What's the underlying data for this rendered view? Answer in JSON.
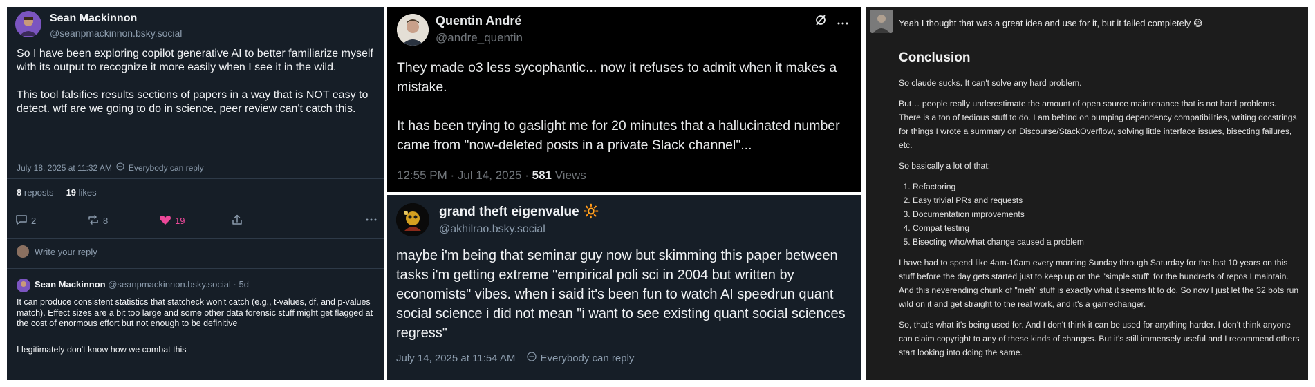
{
  "panel1": {
    "author_name": "Sean Mackinnon",
    "author_handle": "@seanpmackinnon.bsky.social",
    "body": [
      "So I have been exploring copilot generative AI to better familiarize myself with its output to recognize it more easily when I see it in the wild.",
      "This tool falsifies results sections of papers in a way that is NOT easy to detect. wtf are we going to do in science, peer review can't catch this."
    ],
    "timestamp": "July 18, 2025 at 11:32 AM",
    "reply_setting": "Everybody can reply",
    "reposts_count": "8",
    "reposts_label": "reposts",
    "likes_count": "19",
    "likes_label": "likes",
    "actions": {
      "replies": "2",
      "reposts": "8",
      "likes": "19"
    },
    "reply_placeholder": "Write your reply",
    "reply": {
      "author_name": "Sean Mackinnon",
      "author_handle": "@seanpmackinnon.bsky.social",
      "age": "· 5d",
      "body": [
        "It can produce consistent statistics that statcheck won't catch (e.g., t-values, df, and p-values match). Effect sizes are a bit too large and some other data forensic stuff might get flagged at the cost of enormous effort but not enough to be definitive",
        "I legitimately don't know how we combat this"
      ]
    },
    "colors": {
      "background": "#161e27",
      "like": "#ec4899",
      "muted": "#8c9cad"
    }
  },
  "panel2": {
    "author_name": "Quentin André",
    "author_handle": "@andre_quentin",
    "body": [
      "They made o3 less sycophantic... now it refuses to admit when it makes a mistake.",
      "It has been trying to gaslight me for 20 minutes that a hallucinated number came from \"now-deleted posts in a private Slack channel\"..."
    ],
    "timestamp": "12:55 PM · Jul 14, 2025 · ",
    "views_count": "581",
    "views_label": " Views",
    "colors": {
      "background": "#000000",
      "muted": "#71767b"
    }
  },
  "panel3": {
    "author_name": "grand theft eigenvalue",
    "author_emoji": "🔆",
    "author_handle": "@akhilrao.bsky.social",
    "body": "maybe i'm being that seminar guy now but skimming this paper between tasks i'm getting extreme \"empirical poli sci in 2004 but written by economists\" vibes. when i said it's been fun to watch AI speedrun quant social science i did not mean \"i want to see existing quant social sciences regress\"",
    "timestamp": "July 14, 2025 at 11:54 AM",
    "reply_setting": "Everybody can reply"
  },
  "panel4": {
    "top_line": "Yeah I thought that was a great idea and use for it, but it failed completely 😅",
    "heading": "Conclusion",
    "paragraphs_before": [
      "So claude sucks. It can't solve any hard problem.",
      "But… people really underestimate the amount of open source maintenance that is not hard problems. There is a ton of tedious stuff to do. I am behind on bumping dependency compatibilities, writing docstrings for things I wrote a summary on Discourse/StackOverflow, solving little interface issues, bisecting failures, etc.",
      "So basically a lot of that:"
    ],
    "list": [
      "Refactoring",
      "Easy trivial PRs and requests",
      "Documentation improvements",
      "Compat testing",
      "Bisecting who/what change caused a problem"
    ],
    "paragraphs_after": [
      "I have had to spend like 4am-10am every morning Sunday through Saturday for the last 10 years on this stuff before the day gets started just to keep up on the \"simple stuff\" for the hundreds of repos I maintain. And this neverending chunk of \"meh\" stuff is exactly what it seems fit to do. So now I just let the 32 bots run wild on it and get straight to the real work, and it's a gamechanger.",
      "So, that's what it's being used for. And I don't think it can be used for anything harder. I don't think anyone can claim copyright to any of these kinds of changes. But it's still immensely useful and I recommend others start looking into doing the same."
    ]
  }
}
